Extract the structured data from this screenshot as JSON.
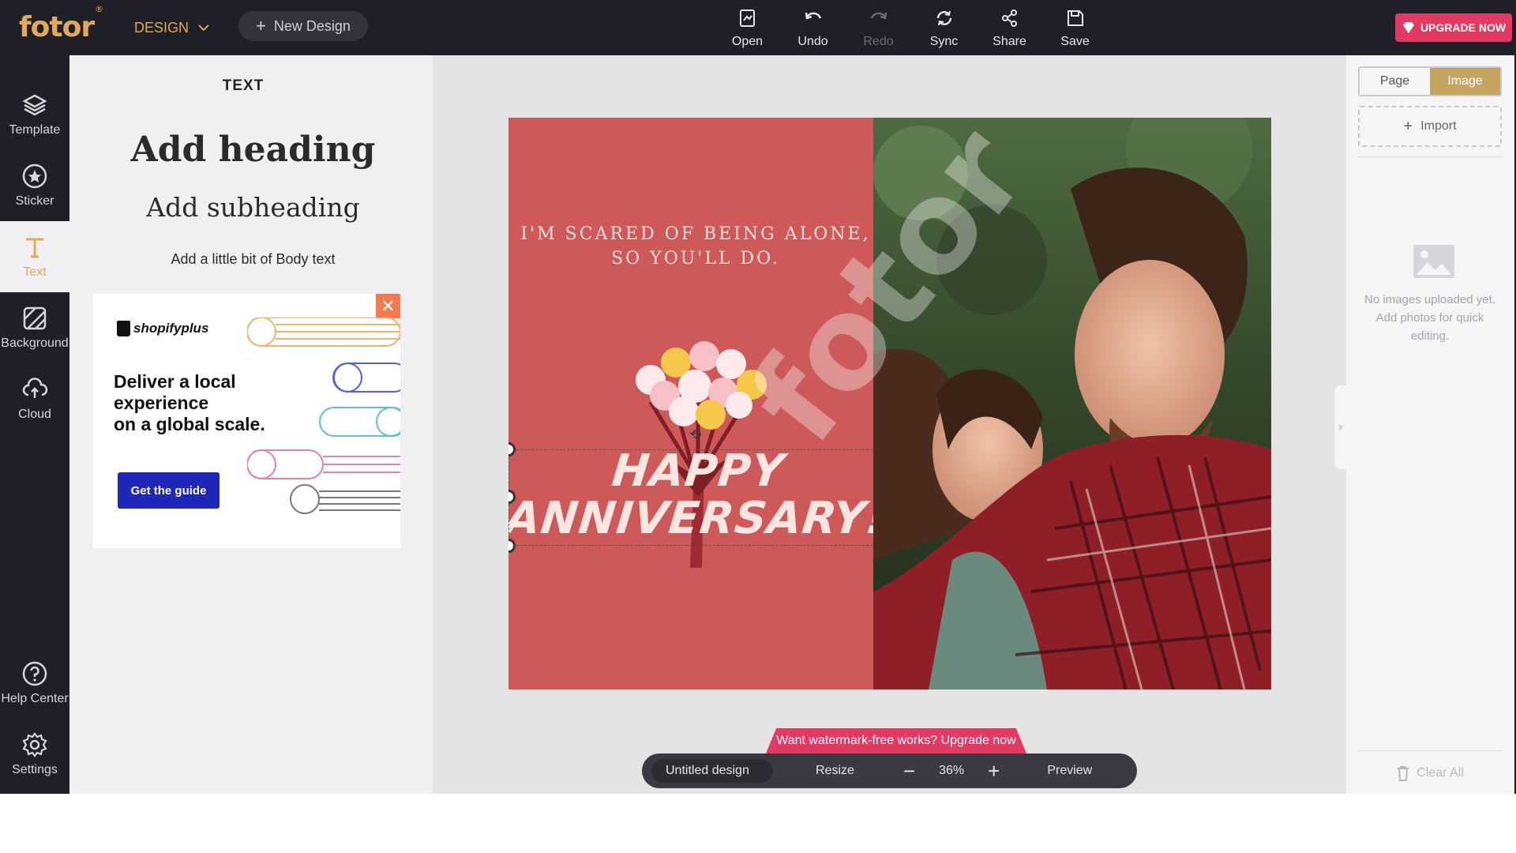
{
  "topbar": {
    "logo": "fotor",
    "logo_mark": "®",
    "design_menu": "DESIGN",
    "new_design": "New Design",
    "tools": [
      {
        "label": "Open",
        "icon": "open-icon",
        "enabled": true
      },
      {
        "label": "Undo",
        "icon": "undo-icon",
        "enabled": true
      },
      {
        "label": "Redo",
        "icon": "redo-icon",
        "enabled": false
      },
      {
        "label": "Sync",
        "icon": "sync-icon",
        "enabled": true
      },
      {
        "label": "Share",
        "icon": "share-icon",
        "enabled": true
      },
      {
        "label": "Save",
        "icon": "save-icon",
        "enabled": true
      }
    ],
    "upgrade": "UPGRADE NOW"
  },
  "rail": {
    "items": [
      {
        "label": "Template",
        "icon": "layers-icon"
      },
      {
        "label": "Sticker",
        "icon": "star-circle-icon"
      },
      {
        "label": "Text",
        "icon": "text-icon",
        "active": true
      },
      {
        "label": "Background",
        "icon": "background-icon"
      },
      {
        "label": "Cloud",
        "icon": "cloud-upload-icon"
      },
      {
        "label": "Help Center",
        "icon": "help-icon"
      },
      {
        "label": "Settings",
        "icon": "gear-icon"
      }
    ]
  },
  "panel": {
    "title": "TEXT",
    "heading": "Add heading",
    "subheading": "Add subheading",
    "body": "Add a little bit of Body text"
  },
  "ad": {
    "brand": "shopifyplus",
    "headline_1": "Deliver a local",
    "headline_2": "experience",
    "headline_3": "on a global scale.",
    "cta": "Get the guide",
    "close": "✕"
  },
  "design": {
    "quote_1": "I'M SCARED OF BEING ALONE,",
    "quote_2": "SO YOU'LL DO.",
    "title_1": "HAPPY",
    "title_2": "ANNIVERSARY!",
    "watermark": "fotor",
    "left_color": "#cd5959"
  },
  "canvas": {
    "watermark_banner": "Want watermark-free works? Upgrade now",
    "doc_name": "Untitled design",
    "resize": "Resize",
    "zoom": "36%",
    "minus": "−",
    "plus": "+",
    "preview": "Preview"
  },
  "rpanel": {
    "tab_page": "Page",
    "tab_image": "Image",
    "import": "Import",
    "empty": "No images uploaded yet. Add photos for quick editing.",
    "clear_all": "Clear All"
  },
  "colors": {
    "accent": "#e0a95b",
    "upgrade": "#e23a63",
    "dark": "#1f1f27"
  }
}
